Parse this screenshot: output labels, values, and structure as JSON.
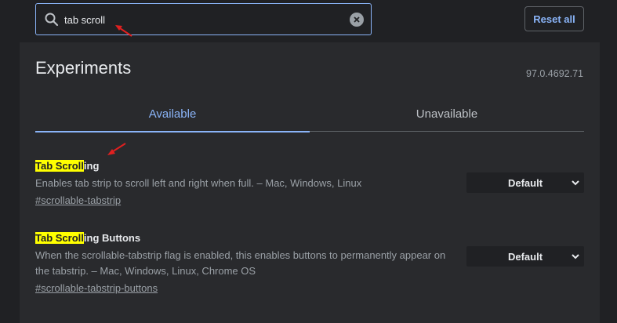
{
  "search": {
    "value": "tab scroll",
    "placeholder": "Search flags"
  },
  "header": {
    "reset_label": "Reset all"
  },
  "main": {
    "title": "Experiments",
    "version": "97.0.4692.71",
    "tabs": [
      {
        "label": "Available",
        "active": true
      },
      {
        "label": "Unavailable",
        "active": false
      }
    ],
    "flags": [
      {
        "name_match": "Tab Scroll",
        "name_rest": "ing",
        "description": "Enables tab strip to scroll left and right when full. – Mac, Windows, Linux",
        "link": "#scrollable-tabstrip",
        "value": "Default"
      },
      {
        "name_match": "Tab Scroll",
        "name_rest": "ing Buttons",
        "description": "When the scrollable-tabstrip flag is enabled, this enables buttons to permanently appear on the tabstrip. – Mac, Windows, Linux, Chrome OS",
        "link": "#scrollable-tabstrip-buttons",
        "value": "Default"
      }
    ]
  },
  "colors": {
    "background": "#202124",
    "panel": "#292a2d",
    "accent": "#8ab4f8",
    "highlight": "#ffff00",
    "annotation_arrow": "#e02020"
  },
  "icons": [
    "search-icon",
    "clear-icon",
    "chevron-down-icon",
    "annotation-arrow-icon"
  ]
}
